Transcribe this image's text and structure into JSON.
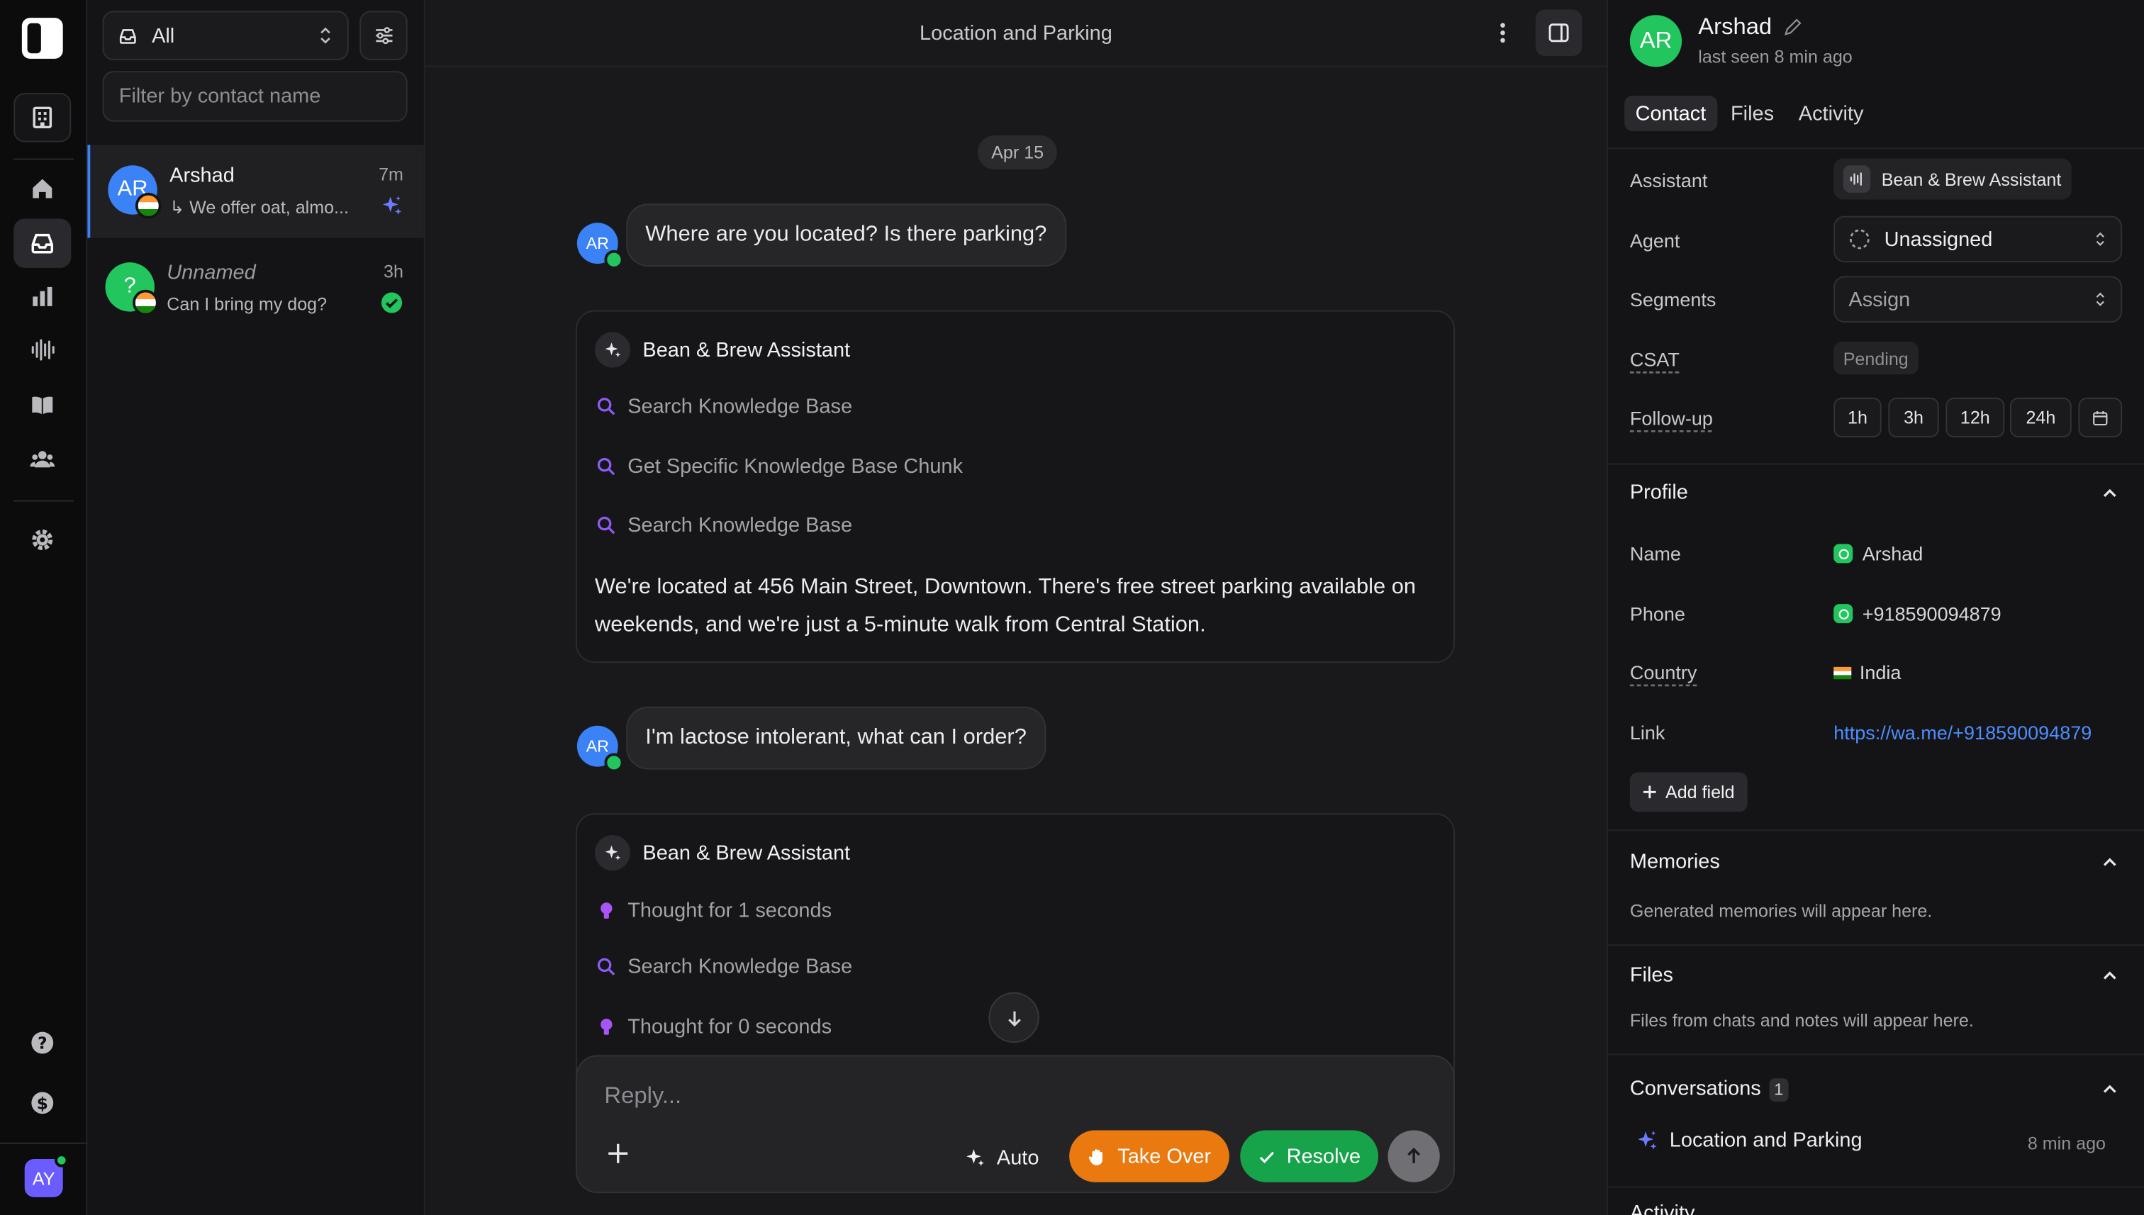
{
  "rail": {
    "icons": [
      "home-icon",
      "inbox-icon",
      "chart-icon",
      "waveform-icon",
      "book-icon",
      "team-icon",
      "gear-icon",
      "help-icon",
      "billing-icon"
    ],
    "user_initials": "AY"
  },
  "list": {
    "filter_value": "All",
    "search_placeholder": "Filter by contact name",
    "conversations": [
      {
        "initials": "AR",
        "name": "Arshad",
        "time": "7m",
        "preview": "We offer oat, almo...",
        "status": "ai"
      },
      {
        "initials": "?",
        "name": "Unnamed",
        "time": "3h",
        "preview": "Can I bring my dog?",
        "status": "resolved"
      }
    ]
  },
  "chat": {
    "title": "Location and Parking",
    "date_divider": "Apr 15",
    "messages": [
      {
        "type": "user",
        "initials": "AR",
        "text": "Where are you located? Is there parking?"
      },
      {
        "type": "assistant",
        "name": "Bean & Brew Assistant",
        "steps": [
          "Search Knowledge Base",
          "Get Specific Knowledge Base Chunk",
          "Search Knowledge Base"
        ],
        "text": "We're located at 456 Main Street, Downtown. There's free street parking available on weekends, and we're just a 5-minute walk from Central Station."
      },
      {
        "type": "user",
        "initials": "AR",
        "text": "I'm lactose intolerant, what can I order?"
      },
      {
        "type": "assistant",
        "name": "Bean & Brew Assistant",
        "steps": [
          "Thought for 1 seconds",
          "Search Knowledge Base",
          "Thought for 0 seconds"
        ]
      }
    ],
    "composer": {
      "placeholder": "Reply...",
      "auto_label": "Auto",
      "takeover_label": "Take Over",
      "resolve_label": "Resolve"
    }
  },
  "contact": {
    "initials": "AR",
    "name": "Arshad",
    "last_seen": "last seen 8 min ago",
    "tabs": [
      "Contact",
      "Files",
      "Activity"
    ],
    "fields": {
      "assistant_label": "Assistant",
      "assistant_value": "Bean & Brew Assistant",
      "agent_label": "Agent",
      "agent_value": "Unassigned",
      "segments_label": "Segments",
      "segments_value": "Assign",
      "csat_label": "CSAT",
      "csat_value": "Pending",
      "followup_label": "Follow-up",
      "followup_options": [
        "1h",
        "3h",
        "12h",
        "24h"
      ]
    },
    "profile": {
      "title": "Profile",
      "name_label": "Name",
      "name_value": "Arshad",
      "phone_label": "Phone",
      "phone_value": "+918590094879",
      "country_label": "Country",
      "country_value": "India",
      "link_label": "Link",
      "link_value": "https://wa.me/+918590094879",
      "add_field": "Add field"
    },
    "memories": {
      "title": "Memories",
      "note": "Generated memories will appear here."
    },
    "files": {
      "title": "Files",
      "note": "Files from chats and notes will appear here."
    },
    "conversations": {
      "title": "Conversations",
      "count": "1",
      "item_title": "Location and Parking",
      "item_time": "8 min ago"
    },
    "activity": {
      "title": "Activity"
    }
  },
  "colors": {
    "accent_blue": "#3b82f6",
    "whatsapp_green": "#22c55e",
    "takeover_orange": "#ea7a10",
    "resolve_green": "#16a34a",
    "link_blue": "#4c8dff"
  }
}
